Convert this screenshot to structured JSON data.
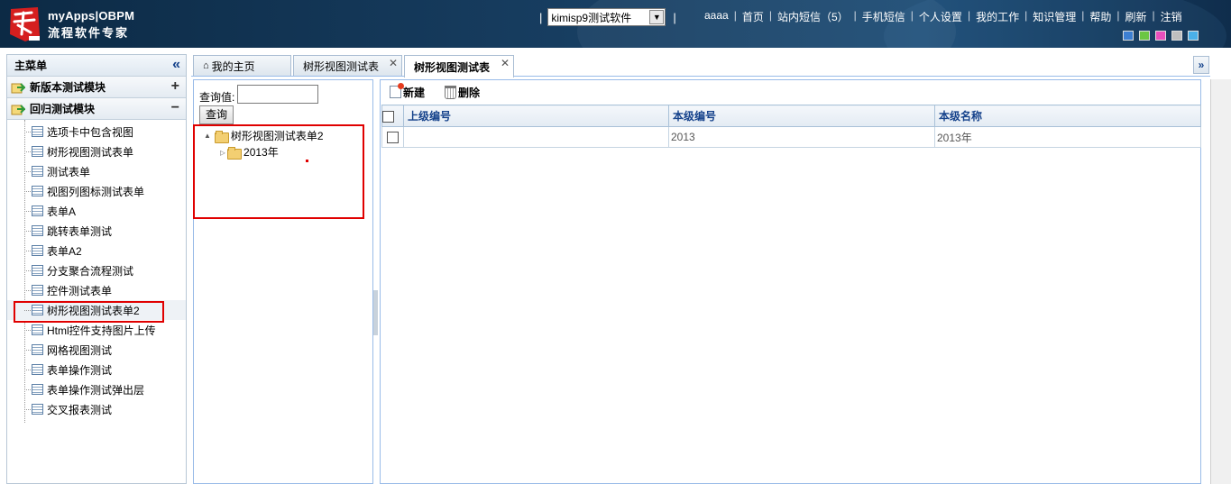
{
  "header": {
    "brand_line1": "myApps|OBPM",
    "brand_line2": "流程软件专家",
    "logo_text": "天翎",
    "system_select": "kimisp9测试软件",
    "nav": [
      "aaaa",
      "首页",
      "站内短信（5）",
      "手机短信",
      "个人设置",
      "我的工作",
      "知识管理",
      "帮助",
      "刷新",
      "注销"
    ],
    "theme_colors": [
      "#3d7fd2",
      "#6cc644",
      "#e94fbd",
      "#bfbfbf",
      "#4ab0e8"
    ]
  },
  "sidebar": {
    "title": "主菜单",
    "collapse_icon": "double-chevron-left",
    "groups": [
      {
        "label": "新版本测试模块",
        "toggle": "+"
      },
      {
        "label": "回归测试模块",
        "toggle": "−"
      }
    ],
    "items": [
      "选项卡中包含视图",
      "树形视图测试表单",
      "测试表单",
      "视图列图标测试表单",
      "表单A",
      "跳转表单测试",
      "表单A2",
      "分支聚合流程测试",
      "控件测试表单",
      "树形视图测试表单2",
      "Html控件支持图片上传",
      "网格视图测试",
      "表单操作测试",
      "表单操作测试弹出层",
      "交叉报表测试"
    ],
    "active_index": 9
  },
  "tabs": [
    {
      "label": "我的主页",
      "icon": "home-icon",
      "closable": false
    },
    {
      "label": "树形视图测试表",
      "closable": true
    },
    {
      "label": "树形视图测试表",
      "closable": true,
      "active": true
    }
  ],
  "tree_panel": {
    "query_label": "查询值:",
    "query_value": "",
    "query_button": "查询",
    "root": "树形视图测试表单2",
    "child": "2013年"
  },
  "grid_panel": {
    "toolbar": {
      "new_label": "新建",
      "delete_label": "删除"
    },
    "columns": [
      "上级编号",
      "本级编号",
      "本级名称"
    ],
    "rows": [
      {
        "parent": "",
        "code": "2013",
        "name": "2013年"
      }
    ]
  }
}
